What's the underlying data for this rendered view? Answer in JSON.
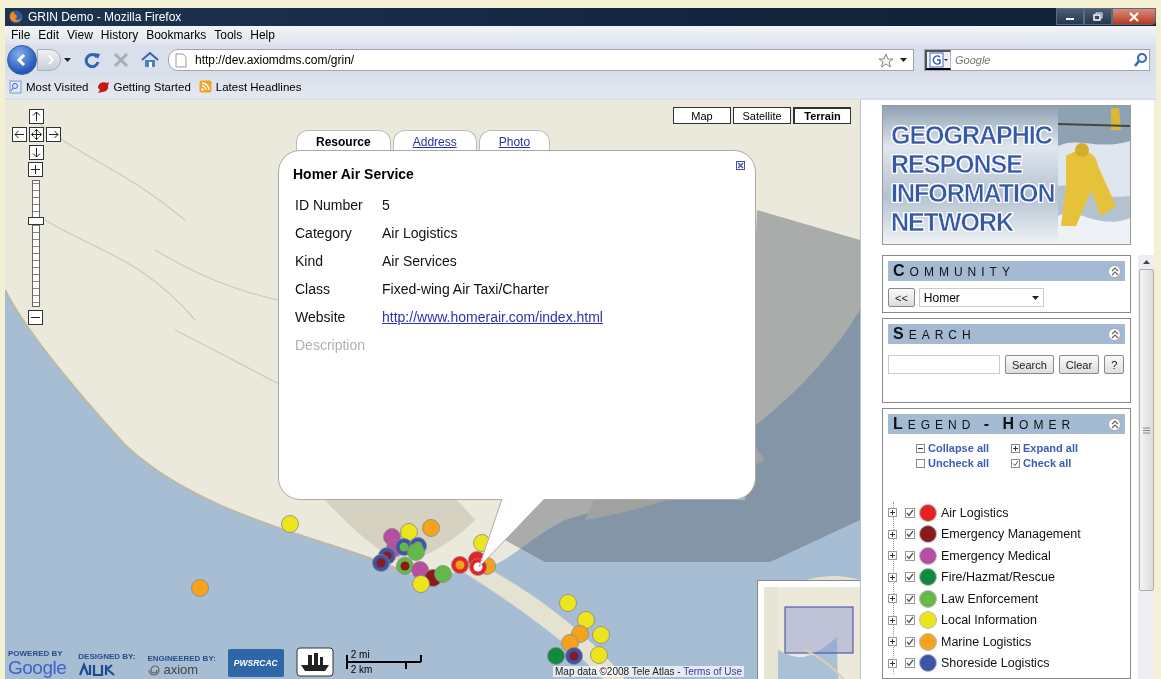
{
  "window": {
    "title": "GRIN Demo - Mozilla Firefox"
  },
  "menu": [
    "File",
    "Edit",
    "View",
    "History",
    "Bookmarks",
    "Tools",
    "Help"
  ],
  "toolbar": {
    "url": "http://dev.axiomdms.com/grin/",
    "search_placeholder": "Google"
  },
  "bookmarks": [
    "Most Visited",
    "Getting Started",
    "Latest Headlines"
  ],
  "map": {
    "map_types": [
      {
        "label": "Map",
        "selected": false
      },
      {
        "label": "Satellite",
        "selected": false
      },
      {
        "label": "Terrain",
        "selected": true
      }
    ],
    "zoom": {
      "level": 0.7
    },
    "popup": {
      "tabs": [
        {
          "label": "Resource",
          "selected": true
        },
        {
          "label": "Address",
          "selected": false
        },
        {
          "label": "Photo",
          "selected": false
        }
      ],
      "title": "Homer Air Service",
      "fields": [
        {
          "label": "ID Number",
          "value": "5",
          "kind": "text"
        },
        {
          "label": "Category",
          "value": "Air Logistics",
          "kind": "text"
        },
        {
          "label": "Kind",
          "value": "Air Services",
          "kind": "text"
        },
        {
          "label": "Class",
          "value": "Fixed-wing Air Taxi/Charter",
          "kind": "text"
        },
        {
          "label": "Website",
          "value": "http://www.homerair.com/index.html",
          "kind": "link"
        },
        {
          "label": "Description",
          "kind": "empty"
        }
      ]
    },
    "footer": {
      "powered_by": "POWERED BY",
      "google": "Google",
      "designed_by": "DESIGNED BY:",
      "engineered_by": "ENGINEERED BY:",
      "axiom": "axiom",
      "pwsrcac": "PWSRCAC",
      "scale": [
        "2 mi",
        "2 km"
      ],
      "copyright": "Map data ©2008 Tele Atlas - ",
      "terms": "Terms of Use"
    }
  },
  "sidebar": {
    "banner_title": "GEOGRAPHIC RESPONSE INFORMATION NETWORK",
    "community": {
      "title": "COMMUNITY",
      "back": "<<",
      "selected": "Homer"
    },
    "search": {
      "title": "SEARCH",
      "buttons": [
        "Search",
        "Clear",
        "?"
      ]
    },
    "legend": {
      "title": "LEGEND - HOMER",
      "actions": [
        {
          "label": "Collapse all",
          "kind": "collapse"
        },
        {
          "label": "Expand all",
          "kind": "expand"
        },
        {
          "label": "Uncheck all",
          "kind": "uncheck"
        },
        {
          "label": "Check all",
          "kind": "check"
        }
      ],
      "items": [
        {
          "label": "Air Logistics",
          "color": "#e82127",
          "checked": true,
          "expanded": false
        },
        {
          "label": "Emergency Management",
          "color": "#8b1a1a",
          "checked": true,
          "expanded": false
        },
        {
          "label": "Emergency Medical",
          "color": "#b64fa2",
          "checked": true,
          "expanded": false
        },
        {
          "label": "Fire/Hazmat/Rescue",
          "color": "#118a3d",
          "checked": true,
          "expanded": false
        },
        {
          "label": "Law Enforcement",
          "color": "#62b947",
          "checked": true,
          "expanded": false
        },
        {
          "label": "Local Information",
          "color": "#ece51d",
          "checked": true,
          "expanded": false
        },
        {
          "label": "Marine Logistics",
          "color": "#f5a31d",
          "checked": true,
          "expanded": false
        },
        {
          "label": "Shoreside Logistics",
          "color": "#3d55a8",
          "checked": true,
          "expanded": false
        }
      ]
    }
  }
}
